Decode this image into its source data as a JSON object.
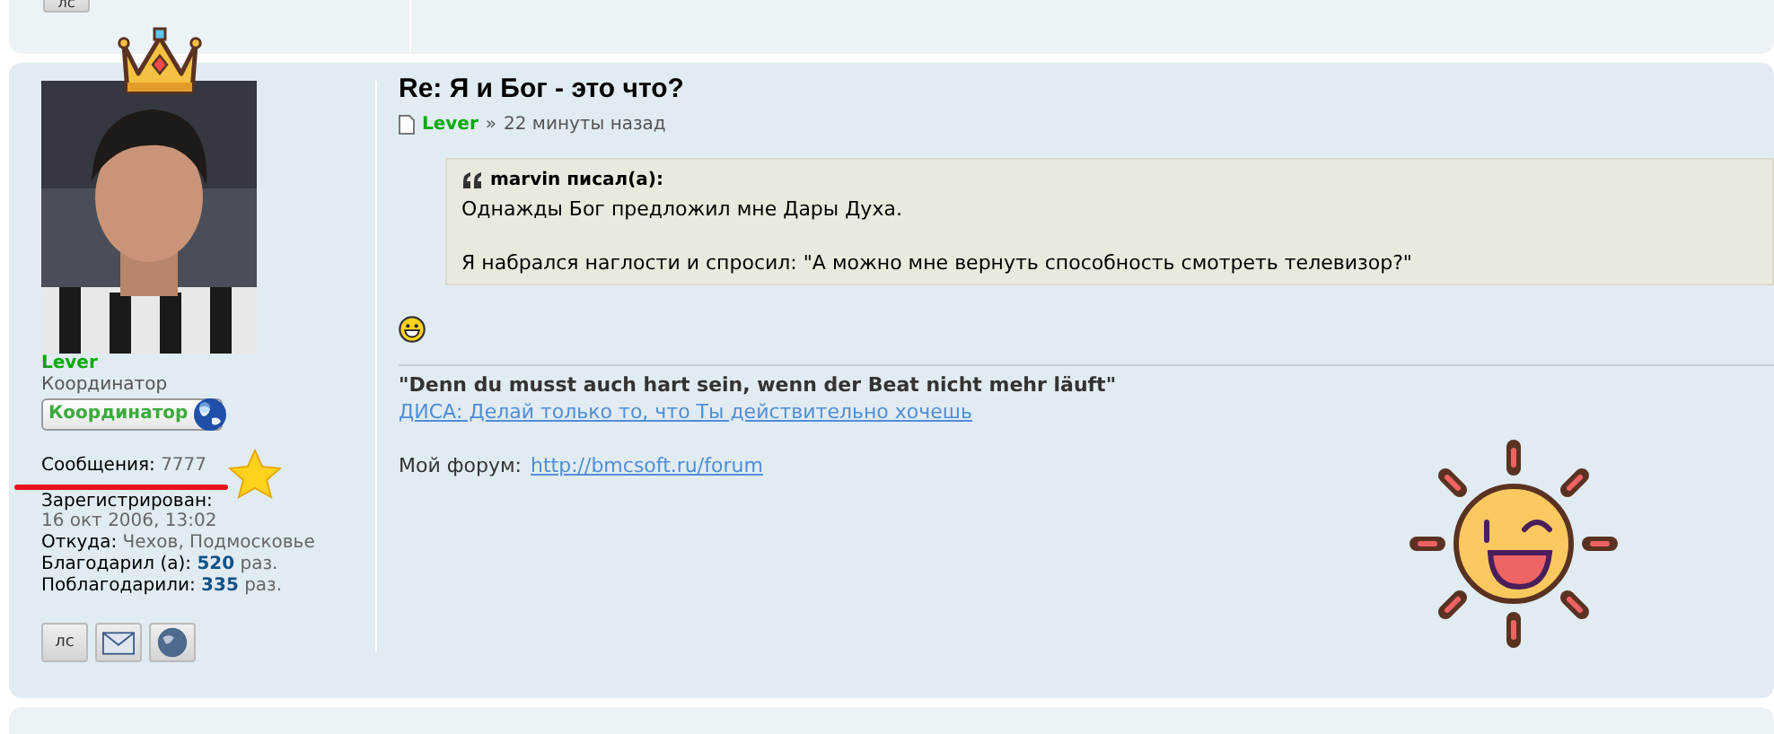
{
  "previous_post": {
    "pm_button": {
      "label": "лс"
    }
  },
  "profile": {
    "username": "Lever",
    "rank": "Координатор",
    "rank_badge": "Координатор",
    "posts": {
      "label": "Сообщения:",
      "value": "7777"
    },
    "registered": {
      "label": "Зарегистрирован:",
      "value": "16 окт 2006, 13:02"
    },
    "location": {
      "label": "Откуда:",
      "value": "Чехов, Подмосковье"
    },
    "thanked": {
      "label": "Благодарил (а):",
      "value": "520",
      "unit": "раз."
    },
    "was_thanked": {
      "label": "Поблагодарили:",
      "value": "335",
      "unit": "раз."
    },
    "pm_button": {
      "label": "лс"
    }
  },
  "post": {
    "title": "Re: Я и Бог - это что?",
    "author": "Lever",
    "separator": "»",
    "time": "22 минуты назад",
    "quote": {
      "author": "marvin писал(а):",
      "paragraphs": [
        "Однажды Бог предложил мне Дары Духа.",
        "Я набрался наглости и спросил: \"А можно мне вернуть способность смотреть телевизор?\""
      ]
    },
    "signature": {
      "motto": "\"Denn du musst auch hart sein, wenn der Beat nicht mehr läuft\"",
      "link": "ДИСА: Делай только то, что Ты действительно хочешь",
      "forum_label": "Мой форум:",
      "forum_link": "http://bmcsoft.ru/forum"
    }
  }
}
